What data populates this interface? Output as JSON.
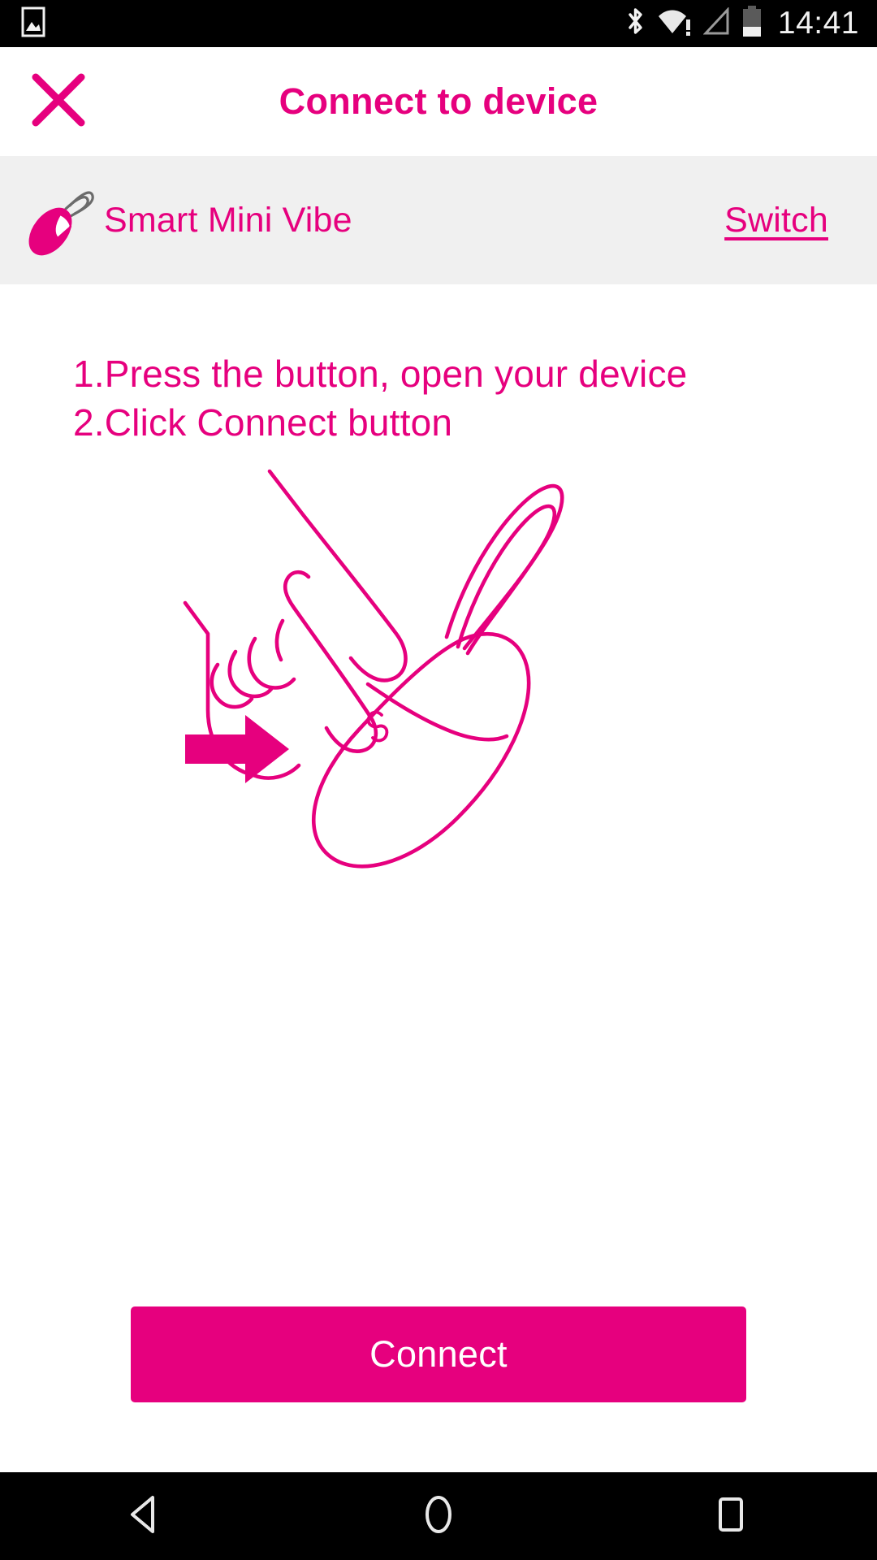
{
  "status_bar": {
    "clock": "14:41",
    "icons": [
      {
        "name": "image-icon",
        "position": "left"
      },
      {
        "name": "bluetooth-icon",
        "position": "right"
      },
      {
        "name": "wifi-warning-icon",
        "position": "right"
      },
      {
        "name": "cellular-signal-icon",
        "position": "right"
      },
      {
        "name": "battery-icon",
        "position": "right"
      }
    ],
    "battery_level_percent": 35,
    "background_color": "#000000",
    "foreground_color": "#f2f2f2"
  },
  "header": {
    "title": "Connect to device",
    "close_icon": "close-icon",
    "accent_color": "#e6007e"
  },
  "device": {
    "name": "Smart Mini Vibe",
    "thumb_icon": "vibe-device-icon",
    "switch_label": "Switch",
    "row_background": "#f0f0f0"
  },
  "instructions": {
    "lines": [
      "1.Press the button, open your device",
      "2.Click Connect button"
    ]
  },
  "illustration": {
    "name": "press-button-illustration",
    "description": "Hand pressing button on egg-shaped device",
    "line_color": "#e6007e",
    "arrow_icon": "right-arrow-icon",
    "button_glyph": "s-button-icon"
  },
  "footer": {
    "connect_label": "Connect",
    "button_color": "#e6007e",
    "button_text_color": "#ffffff"
  },
  "nav_bar": {
    "back_icon": "back-triangle-icon",
    "home_icon": "home-circle-icon",
    "recents_icon": "recents-square-icon",
    "background_color": "#000000"
  }
}
